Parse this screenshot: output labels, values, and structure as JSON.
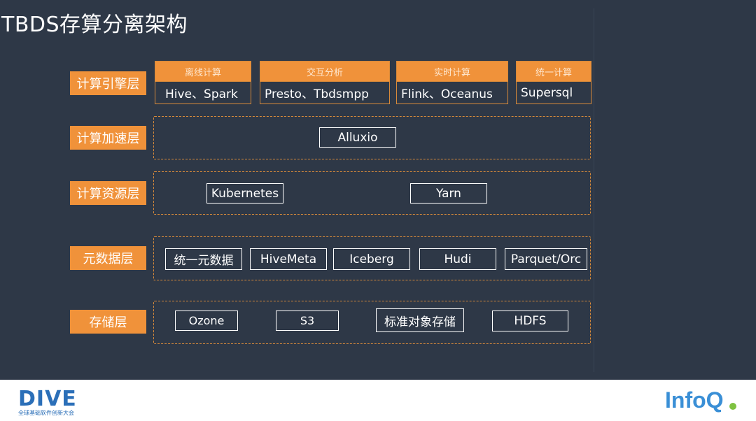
{
  "title": "TBDS存算分离架构",
  "layers": [
    {
      "label": "计算引擎层"
    },
    {
      "label": "计算加速层"
    },
    {
      "label": "计算资源层"
    },
    {
      "label": "元数据层"
    },
    {
      "label": "存储层"
    }
  ],
  "engines": [
    {
      "head": "离线计算",
      "body": "Hive、Spark"
    },
    {
      "head": "交互分析",
      "body": "Presto、Tbdsmpp"
    },
    {
      "head": "实时计算",
      "body": "Flink、Oceanus"
    },
    {
      "head": "统一计算",
      "body": "Supersql"
    }
  ],
  "acceleration": [
    "Alluxio"
  ],
  "resources": [
    "Kubernetes",
    "Yarn"
  ],
  "metadata": [
    "统一元数据",
    "HiveMeta",
    "Iceberg",
    "Hudi",
    "Parquet/Orc"
  ],
  "storage": [
    "Ozone",
    "S3",
    "标准对象存储",
    "HDFS"
  ],
  "footer": {
    "left_logo": "DIVE",
    "left_logo_sub": "全球基础软件创新大会",
    "right_logo": "InfoQ"
  },
  "colors": {
    "background": "#2e3847",
    "accent": "#f0923a",
    "dashed_border": "#d88a3a",
    "box_border": "#ffffff",
    "infoq_blue": "#3a8fd6",
    "dive_blue": "#2b6fb8"
  }
}
